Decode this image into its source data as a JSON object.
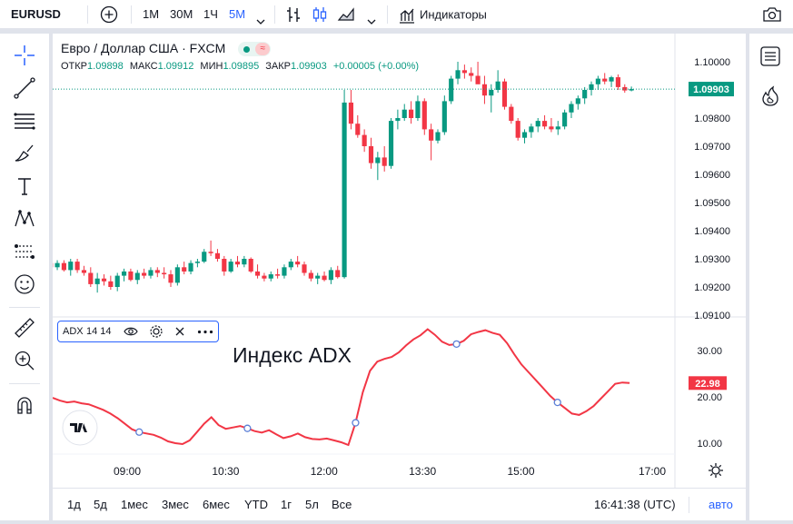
{
  "topbar": {
    "symbol": "EURUSD",
    "intervals": [
      "1М",
      "30М",
      "1Ч",
      "5М"
    ],
    "active_interval": "5М",
    "indicators_label": "Индикаторы"
  },
  "legend": {
    "title": "Евро / Доллар США · FXCM",
    "ohlc": [
      {
        "label": "ОТКР",
        "value": "1.09898"
      },
      {
        "label": "МАКС",
        "value": "1.09912"
      },
      {
        "label": "МИН",
        "value": "1.09895"
      },
      {
        "label": "ЗАКР",
        "value": "1.09903"
      }
    ],
    "change": "+0.00005 (+0.00%)"
  },
  "price_axis": {
    "ticks": [
      "1.10000",
      "1.09900",
      "1.09800",
      "1.09700",
      "1.09600",
      "1.09500",
      "1.09400",
      "1.09300",
      "1.09200",
      "1.09100"
    ],
    "last_price": "1.09903",
    "last_price_color": "#089981"
  },
  "indicator": {
    "name": "ADX",
    "params": "14 14",
    "annotation": "Индекс ADX",
    "axis_ticks": [
      "30.00",
      "20.00",
      "10.00"
    ],
    "last_value": "22.98",
    "line_color": "#f23645"
  },
  "time_axis": {
    "ticks": [
      "09:00",
      "10:30",
      "12:00",
      "13:30",
      "15:00",
      "17:00"
    ]
  },
  "bottom": {
    "periods": [
      "1д",
      "5д",
      "1мес",
      "3мес",
      "6мес",
      "YTD",
      "1г",
      "5л",
      "Все"
    ],
    "clock": "16:41:38 (UTC)",
    "auto_label": "авто"
  },
  "colors": {
    "up": "#089981",
    "down": "#f23645",
    "accent": "#2962ff"
  },
  "chart_data": [
    {
      "type": "candlestick",
      "title": "Евро / Доллар США · FXCM",
      "x_range": [
        "07:50",
        "16:41"
      ],
      "ylim": [
        1.0909,
        1.1003
      ],
      "note": "5-minute candles; estimated from the screenshot",
      "candles": [
        [
          1.09285,
          1.093,
          1.09255,
          1.0927
        ],
        [
          1.0927,
          1.09295,
          1.0926,
          1.09285
        ],
        [
          1.09285,
          1.09295,
          1.09255,
          1.0926
        ],
        [
          1.0926,
          1.093,
          1.0924,
          1.0929
        ],
        [
          1.0929,
          1.093,
          1.0925,
          1.0926
        ],
        [
          1.0926,
          1.09275,
          1.0924,
          1.0925
        ],
        [
          1.0925,
          1.0927,
          1.092,
          1.0921
        ],
        [
          1.0921,
          1.0925,
          1.0918,
          1.0923
        ],
        [
          1.0923,
          1.09245,
          1.09205,
          1.0922
        ],
        [
          1.0922,
          1.0924,
          1.0919,
          1.092
        ],
        [
          1.092,
          1.0925,
          1.09185,
          1.0924
        ],
        [
          1.0924,
          1.09265,
          1.0922,
          1.09255
        ],
        [
          1.09255,
          1.09265,
          1.0922,
          1.09225
        ],
        [
          1.09225,
          1.0926,
          1.0921,
          1.0925
        ],
        [
          1.0925,
          1.09265,
          1.0923,
          1.0924
        ],
        [
          1.0924,
          1.0927,
          1.0923,
          1.0926
        ],
        [
          1.0926,
          1.0927,
          1.09235,
          1.0925
        ],
        [
          1.0925,
          1.0927,
          1.0923,
          1.09245
        ],
        [
          1.09245,
          1.0926,
          1.092,
          1.09215
        ],
        [
          1.09215,
          1.0928,
          1.09205,
          1.0927
        ],
        [
          1.0927,
          1.0929,
          1.09245,
          1.09255
        ],
        [
          1.09255,
          1.09295,
          1.09245,
          1.09285
        ],
        [
          1.09285,
          1.093,
          1.0927,
          1.0929
        ],
        [
          1.0929,
          1.09335,
          1.09285,
          1.09325
        ],
        [
          1.09325,
          1.09365,
          1.0931,
          1.0932
        ],
        [
          1.0932,
          1.09335,
          1.0929,
          1.093
        ],
        [
          1.093,
          1.0931,
          1.0924,
          1.09255
        ],
        [
          1.09255,
          1.093,
          1.0925,
          1.0929
        ],
        [
          1.0929,
          1.0931,
          1.0927,
          1.0928
        ],
        [
          1.0928,
          1.0931,
          1.0927,
          1.093
        ],
        [
          1.093,
          1.09305,
          1.0925,
          1.09255
        ],
        [
          1.09255,
          1.0928,
          1.0923,
          1.0924
        ],
        [
          1.0924,
          1.0925,
          1.0922,
          1.0923
        ],
        [
          1.0923,
          1.09255,
          1.0922,
          1.09245
        ],
        [
          1.09245,
          1.09265,
          1.0923,
          1.0924
        ],
        [
          1.0924,
          1.0928,
          1.0923,
          1.0927
        ],
        [
          1.0927,
          1.093,
          1.0926,
          1.0929
        ],
        [
          1.0929,
          1.0931,
          1.0927,
          1.0928
        ],
        [
          1.0928,
          1.0929,
          1.0924,
          1.0925
        ],
        [
          1.0925,
          1.0926,
          1.0922,
          1.0923
        ],
        [
          1.0923,
          1.0925,
          1.0921,
          1.0924
        ],
        [
          1.0924,
          1.09255,
          1.0922,
          1.09225
        ],
        [
          1.09225,
          1.0927,
          1.0921,
          1.0926
        ],
        [
          1.0926,
          1.09275,
          1.0923,
          1.09235
        ],
        [
          1.09235,
          1.099,
          1.0923,
          1.09855
        ],
        [
          1.09855,
          1.099,
          1.0976,
          1.0978
        ],
        [
          1.0978,
          1.0981,
          1.0973,
          1.0974
        ],
        [
          1.0974,
          1.0976,
          1.0968,
          1.097
        ],
        [
          1.097,
          1.0973,
          1.0962,
          1.0964
        ],
        [
          1.0964,
          1.0968,
          1.0958,
          1.0966
        ],
        [
          1.0966,
          1.097,
          1.0961,
          1.0963
        ],
        [
          1.0963,
          1.098,
          1.0962,
          1.0979
        ],
        [
          1.0979,
          1.0983,
          1.0976,
          1.098
        ],
        [
          1.098,
          1.0985,
          1.0979,
          1.0983
        ],
        [
          1.0983,
          1.0986,
          1.0978,
          1.098
        ],
        [
          1.098,
          1.0988,
          1.0979,
          1.0986
        ],
        [
          1.0986,
          1.0987,
          1.0974,
          1.0976
        ],
        [
          1.0976,
          1.0978,
          1.0965,
          1.0972
        ],
        [
          1.0972,
          1.0976,
          1.0971,
          1.0975
        ],
        [
          1.0975,
          1.0988,
          1.0974,
          1.0986
        ],
        [
          1.0986,
          1.0995,
          1.0985,
          1.0994
        ],
        [
          1.0994,
          1.1,
          1.0992,
          1.0997
        ],
        [
          1.0997,
          1.0999,
          1.0994,
          1.0996
        ],
        [
          1.0996,
          1.0998,
          1.0993,
          1.0995
        ],
        [
          1.0995,
          1.1,
          1.0994,
          1.0992
        ],
        [
          1.0992,
          1.0995,
          1.0985,
          1.0988
        ],
        [
          1.0988,
          1.0992,
          1.0982,
          1.099
        ],
        [
          1.099,
          1.0997,
          1.0989,
          1.0993
        ],
        [
          1.0993,
          1.0994,
          1.0983,
          1.0984
        ],
        [
          1.0984,
          1.0985,
          1.0978,
          1.0979
        ],
        [
          1.0979,
          1.098,
          1.0972,
          1.0973
        ],
        [
          1.0973,
          1.0976,
          1.0971,
          1.0975
        ],
        [
          1.0975,
          1.0978,
          1.0973,
          1.0977
        ],
        [
          1.0977,
          1.098,
          1.0975,
          1.0979
        ],
        [
          1.0979,
          1.0981,
          1.0976,
          1.0977
        ],
        [
          1.0977,
          1.098,
          1.0975,
          1.0976
        ],
        [
          1.0976,
          1.0979,
          1.0974,
          1.0977
        ],
        [
          1.0977,
          1.0983,
          1.0976,
          1.0982
        ],
        [
          1.0982,
          1.0986,
          1.098,
          1.0985
        ],
        [
          1.0985,
          1.0988,
          1.0983,
          1.0987
        ],
        [
          1.0987,
          1.0991,
          1.0985,
          1.099
        ],
        [
          1.099,
          1.0993,
          1.0988,
          1.0992
        ],
        [
          1.0992,
          1.0995,
          1.099,
          1.0994
        ],
        [
          1.0994,
          1.0996,
          1.0992,
          1.0993
        ],
        [
          1.0993,
          1.0995,
          1.0991,
          1.09945
        ],
        [
          1.09945,
          1.09955,
          1.099,
          1.0991
        ],
        [
          1.0991,
          1.0992,
          1.0989,
          1.09898
        ],
        [
          1.09898,
          1.09912,
          1.09895,
          1.09903
        ]
      ]
    },
    {
      "type": "line",
      "title": "ADX 14 14",
      "x_range": [
        "07:50",
        "16:41"
      ],
      "ylim": [
        5,
        37
      ],
      "values": [
        19.8,
        19.2,
        18.8,
        19.0,
        18.6,
        18.4,
        17.8,
        17.2,
        16.4,
        15.4,
        14.2,
        13.0,
        12.4,
        12.1,
        11.8,
        11.2,
        10.4,
        10.0,
        9.8,
        10.6,
        12.4,
        14.2,
        15.6,
        13.9,
        13.1,
        13.4,
        13.7,
        13.2,
        12.6,
        12.3,
        12.8,
        11.9,
        11.1,
        11.5,
        12.1,
        11.3,
        10.9,
        10.8,
        11.0,
        10.6,
        10.2,
        9.6,
        14.4,
        21.0,
        25.6,
        27.6,
        28.2,
        28.6,
        29.6,
        31.1,
        32.4,
        33.3,
        34.6,
        33.4,
        31.9,
        31.2,
        31.4,
        32.1,
        33.5,
        34.0,
        34.4,
        33.8,
        33.4,
        31.6,
        29.2,
        27.0,
        25.3,
        23.6,
        21.9,
        20.2,
        18.8,
        17.6,
        16.4,
        16.1,
        16.9,
        18.0,
        19.6,
        21.2,
        22.8,
        23.1,
        22.98
      ],
      "marker_indices": [
        12,
        27,
        42,
        56,
        70
      ]
    }
  ]
}
